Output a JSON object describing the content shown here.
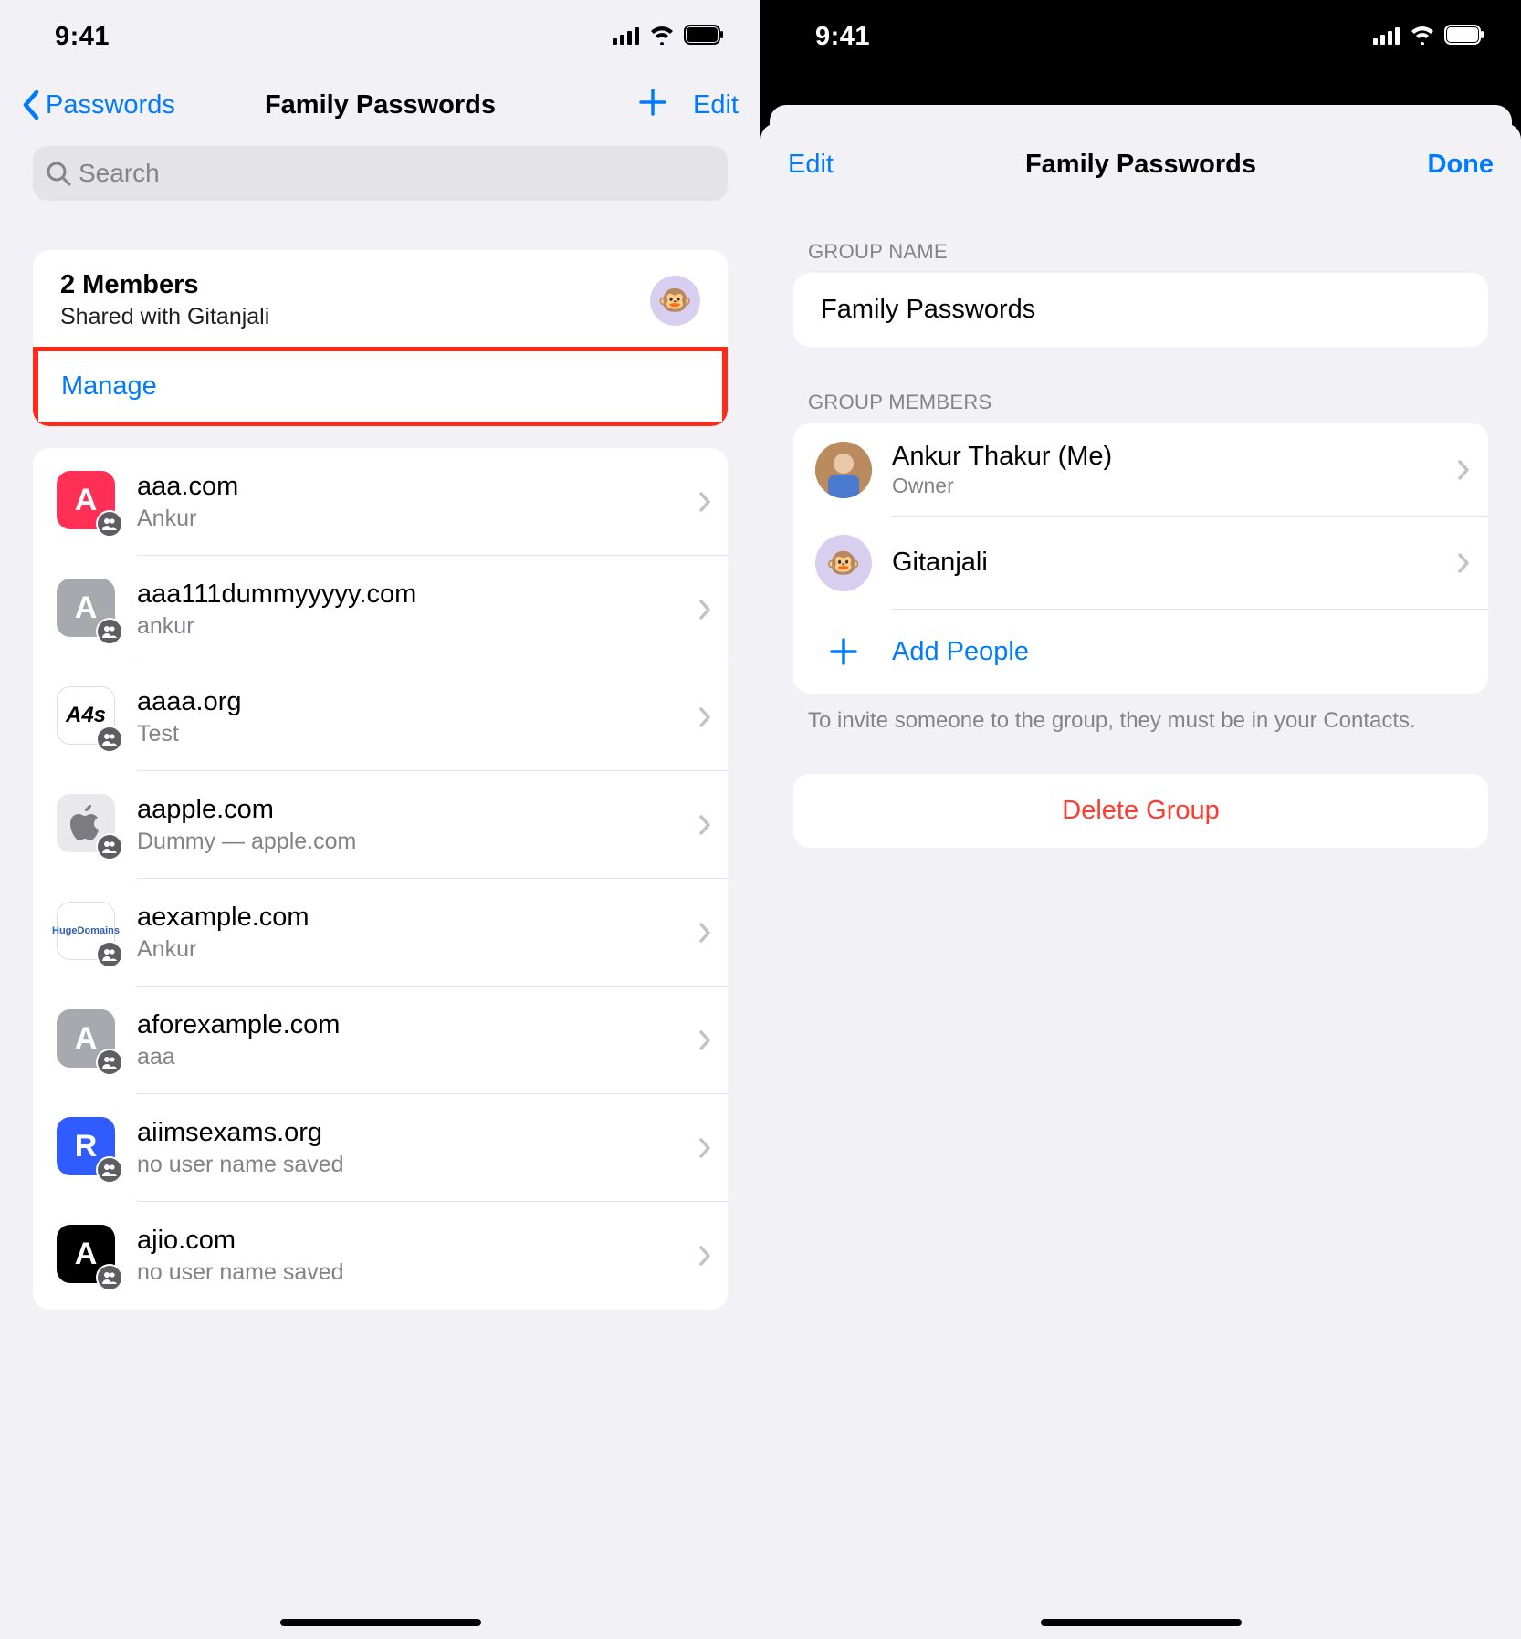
{
  "left": {
    "status_time": "9:41",
    "nav_back": "Passwords",
    "nav_title": "Family Passwords",
    "nav_edit": "Edit",
    "search_placeholder": "Search",
    "members_title": "2 Members",
    "members_subtitle": "Shared with Gitanjali",
    "members_avatar_emoji": "🐵",
    "manage_label": "Manage",
    "passwords": [
      {
        "site": "aaa.com",
        "user": "Ankur",
        "iconClass": "red",
        "iconText": "A"
      },
      {
        "site": "aaa111dummyyyyy.com",
        "user": "ankur",
        "iconClass": "gray",
        "iconText": "A"
      },
      {
        "site": "aaaa.org",
        "user": "Test",
        "iconClass": "white",
        "iconText": "A4s"
      },
      {
        "site": "aapple.com",
        "user": "Dummy — apple.com",
        "iconClass": "applegray",
        "iconText": ""
      },
      {
        "site": "aexample.com",
        "user": "Ankur",
        "iconClass": "hd",
        "iconText": "HugeDomains"
      },
      {
        "site": "aforexample.com",
        "user": "aaa",
        "iconClass": "gray",
        "iconText": "A"
      },
      {
        "site": "aiimsexams.org",
        "user": "no user name saved",
        "iconClass": "blue",
        "iconText": "R"
      },
      {
        "site": "ajio.com",
        "user": "no user name saved",
        "iconClass": "black",
        "iconText": "A"
      }
    ]
  },
  "right": {
    "status_time": "9:41",
    "nav_edit": "Edit",
    "nav_title": "Family Passwords",
    "nav_done": "Done",
    "section_group_name": "GROUP NAME",
    "group_name_value": "Family Passwords",
    "section_group_members": "GROUP MEMBERS",
    "members": [
      {
        "name": "Ankur Thakur (Me)",
        "role": "Owner",
        "avatar": "photo"
      },
      {
        "name": "Gitanjali",
        "role": "",
        "avatar": "monkey"
      }
    ],
    "add_people": "Add People",
    "footer_note": "To invite someone to the group, they must be in your Contacts.",
    "delete_label": "Delete Group"
  }
}
